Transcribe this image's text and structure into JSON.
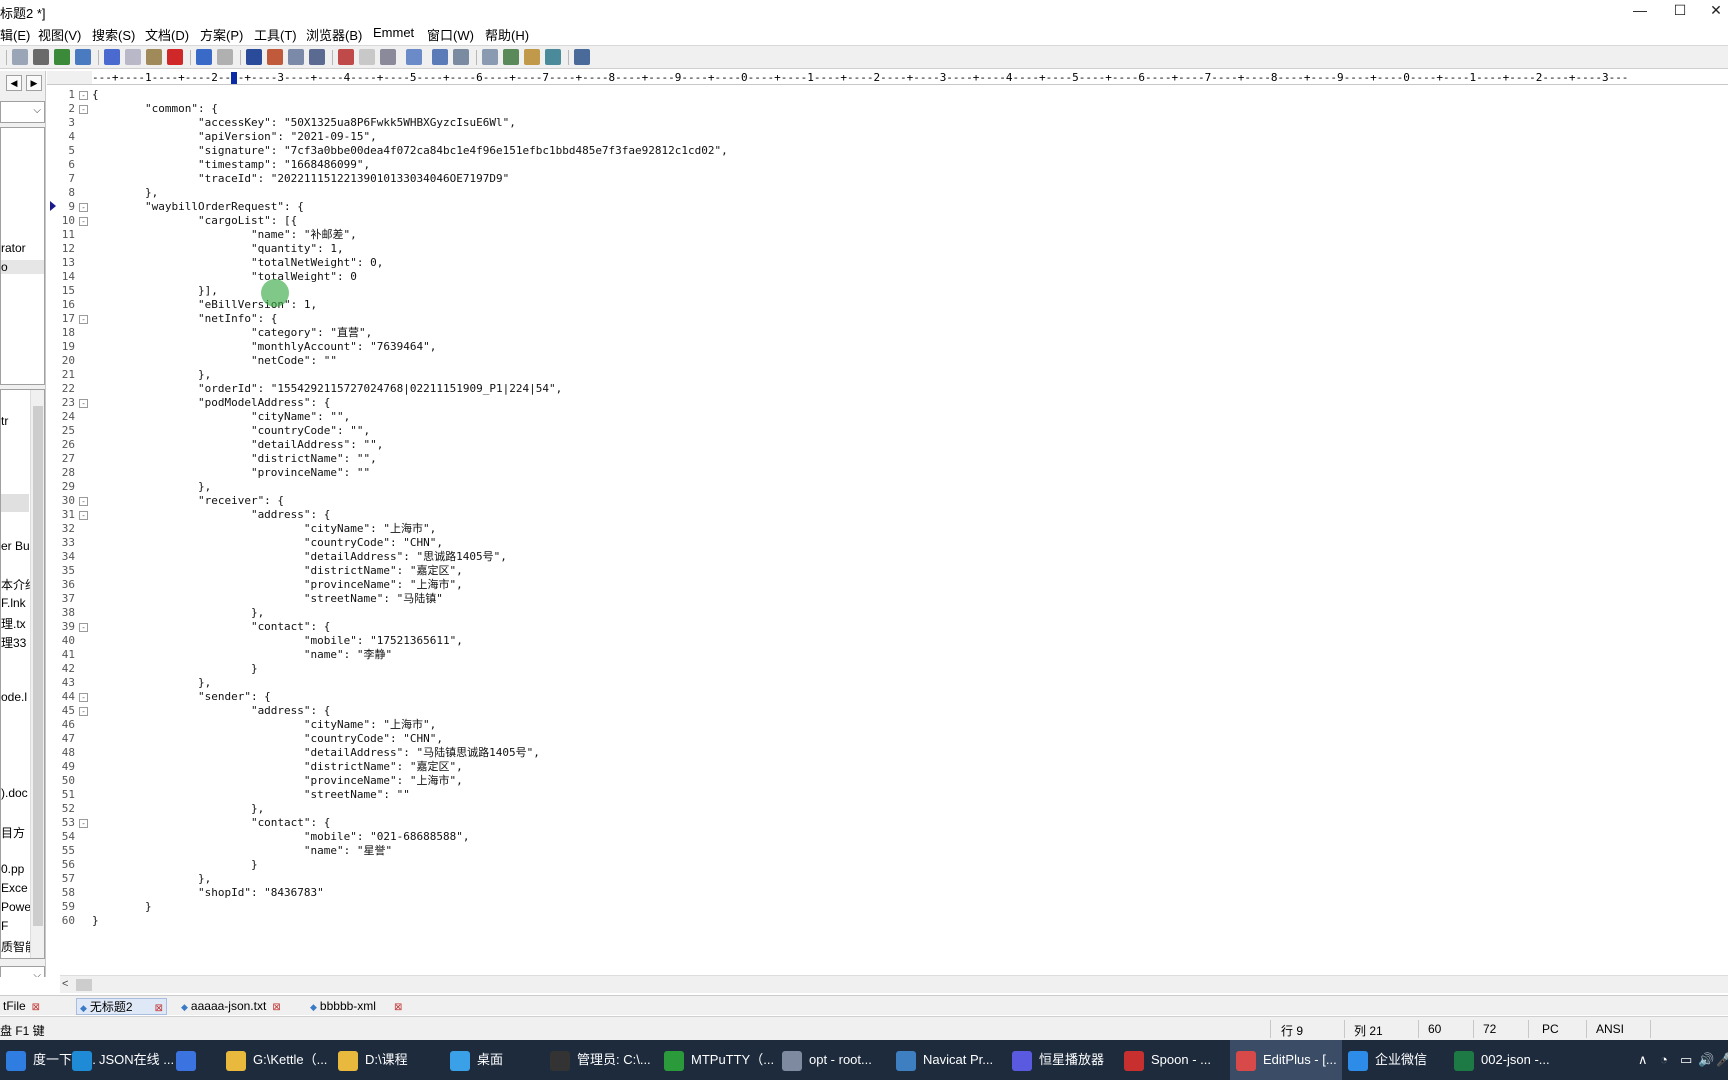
{
  "window": {
    "title": "标题2 *]",
    "controls": [
      "—",
      "☐",
      "✕"
    ]
  },
  "menu": [
    "辑(E)",
    "视图(V)",
    "搜索(S)",
    "文档(D)",
    "方案(P)",
    "工具(T)",
    "浏览器(B)",
    "Emmet",
    "窗口(W)",
    "帮助(H)"
  ],
  "leftpanel": {
    "top_items": [
      "rator",
      "o"
    ],
    "file_items": [
      "tr",
      "er Bu",
      "本介绍",
      "F.lnk",
      "理.tx",
      "理33",
      "ode.l",
      ").doc",
      "目方",
      "0.pp",
      "Exce",
      "Powe",
      "F",
      "质智能"
    ]
  },
  "ruler": {
    "text": "---+----1----+----2----+----3----+----4----+----5----+----6----+----7----+----8----+----9----+----0----+----1----+----2----+----3----+----4----+----5----+----6----+----7----+----8----+----9----+----0----+----1----+----2----+----3---"
  },
  "editor": {
    "current_line": 9,
    "lines": [
      {
        "n": "1",
        "fold": "-",
        "text": "{"
      },
      {
        "n": "2",
        "fold": "-",
        "text": "        \"common\": {"
      },
      {
        "n": "3",
        "fold": "",
        "text": "                \"accessKey\": \"50X1325ua8P6Fwkk5WHBXGyzcIsuE6Wl\","
      },
      {
        "n": "4",
        "fold": "",
        "text": "                \"apiVersion\": \"2021-09-15\","
      },
      {
        "n": "5",
        "fold": "",
        "text": "                \"signature\": \"7cf3a0bbe00dea4f072ca84bc1e4f96e151efbc1bbd485e7f3fae92812c1cd02\","
      },
      {
        "n": "6",
        "fold": "",
        "text": "                \"timestamp\": \"1668486099\","
      },
      {
        "n": "7",
        "fold": "",
        "text": "                \"traceId\": \"20221115122139010133034046OE7197D9\""
      },
      {
        "n": "8",
        "fold": "",
        "text": "        },"
      },
      {
        "n": "9",
        "fold": "-",
        "text": "        \"waybillOrderRequest\": {"
      },
      {
        "n": "10",
        "fold": "-",
        "text": "                \"cargoList\": [{"
      },
      {
        "n": "11",
        "fold": "",
        "text": "                        \"name\": \"补邮差\","
      },
      {
        "n": "12",
        "fold": "",
        "text": "                        \"quantity\": 1,"
      },
      {
        "n": "13",
        "fold": "",
        "text": "                        \"totalNetWeight\": 0,"
      },
      {
        "n": "14",
        "fold": "",
        "text": "                        \"totalWeight\": 0"
      },
      {
        "n": "15",
        "fold": "",
        "text": "                }],"
      },
      {
        "n": "16",
        "fold": "",
        "text": "                \"eBillVersion\": 1,"
      },
      {
        "n": "17",
        "fold": "-",
        "text": "                \"netInfo\": {"
      },
      {
        "n": "18",
        "fold": "",
        "text": "                        \"category\": \"直营\","
      },
      {
        "n": "19",
        "fold": "",
        "text": "                        \"monthlyAccount\": \"7639464\","
      },
      {
        "n": "20",
        "fold": "",
        "text": "                        \"netCode\": \"\""
      },
      {
        "n": "21",
        "fold": "",
        "text": "                },"
      },
      {
        "n": "22",
        "fold": "",
        "text": "                \"orderId\": \"1554292115727024768|02211151909_P1|224|54\","
      },
      {
        "n": "23",
        "fold": "-",
        "text": "                \"podModelAddress\": {"
      },
      {
        "n": "24",
        "fold": "",
        "text": "                        \"cityName\": \"\","
      },
      {
        "n": "25",
        "fold": "",
        "text": "                        \"countryCode\": \"\","
      },
      {
        "n": "26",
        "fold": "",
        "text": "                        \"detailAddress\": \"\","
      },
      {
        "n": "27",
        "fold": "",
        "text": "                        \"districtName\": \"\","
      },
      {
        "n": "28",
        "fold": "",
        "text": "                        \"provinceName\": \"\""
      },
      {
        "n": "29",
        "fold": "",
        "text": "                },"
      },
      {
        "n": "30",
        "fold": "-",
        "text": "                \"receiver\": {"
      },
      {
        "n": "31",
        "fold": "-",
        "text": "                        \"address\": {"
      },
      {
        "n": "32",
        "fold": "",
        "text": "                                \"cityName\": \"上海市\","
      },
      {
        "n": "33",
        "fold": "",
        "text": "                                \"countryCode\": \"CHN\","
      },
      {
        "n": "34",
        "fold": "",
        "text": "                                \"detailAddress\": \"思诚路1405号\","
      },
      {
        "n": "35",
        "fold": "",
        "text": "                                \"districtName\": \"嘉定区\","
      },
      {
        "n": "36",
        "fold": "",
        "text": "                                \"provinceName\": \"上海市\","
      },
      {
        "n": "37",
        "fold": "",
        "text": "                                \"streetName\": \"马陆镇\""
      },
      {
        "n": "38",
        "fold": "",
        "text": "                        },"
      },
      {
        "n": "39",
        "fold": "-",
        "text": "                        \"contact\": {"
      },
      {
        "n": "40",
        "fold": "",
        "text": "                                \"mobile\": \"17521365611\","
      },
      {
        "n": "41",
        "fold": "",
        "text": "                                \"name\": \"李静\""
      },
      {
        "n": "42",
        "fold": "",
        "text": "                        }"
      },
      {
        "n": "43",
        "fold": "",
        "text": "                },"
      },
      {
        "n": "44",
        "fold": "-",
        "text": "                \"sender\": {"
      },
      {
        "n": "45",
        "fold": "-",
        "text": "                        \"address\": {"
      },
      {
        "n": "46",
        "fold": "",
        "text": "                                \"cityName\": \"上海市\","
      },
      {
        "n": "47",
        "fold": "",
        "text": "                                \"countryCode\": \"CHN\","
      },
      {
        "n": "48",
        "fold": "",
        "text": "                                \"detailAddress\": \"马陆镇思诚路1405号\","
      },
      {
        "n": "49",
        "fold": "",
        "text": "                                \"districtName\": \"嘉定区\","
      },
      {
        "n": "50",
        "fold": "",
        "text": "                                \"provinceName\": \"上海市\","
      },
      {
        "n": "51",
        "fold": "",
        "text": "                                \"streetName\": \"\""
      },
      {
        "n": "52",
        "fold": "",
        "text": "                        },"
      },
      {
        "n": "53",
        "fold": "-",
        "text": "                        \"contact\": {"
      },
      {
        "n": "54",
        "fold": "",
        "text": "                                \"mobile\": \"021-68688588\","
      },
      {
        "n": "55",
        "fold": "",
        "text": "                                \"name\": \"星誉\""
      },
      {
        "n": "56",
        "fold": "",
        "text": "                        }"
      },
      {
        "n": "57",
        "fold": "",
        "text": "                },"
      },
      {
        "n": "58",
        "fold": "",
        "text": "                \"shopId\": \"8436783\""
      },
      {
        "n": "59",
        "fold": "",
        "text": "        }"
      },
      {
        "n": "60",
        "fold": "",
        "text": "}"
      }
    ]
  },
  "doctabs": [
    {
      "label": "tFile",
      "active": false
    },
    {
      "label": "无标题2",
      "active": true
    },
    {
      "label": "aaaaa-json.txt",
      "active": false
    },
    {
      "label": "bbbbb-xml",
      "active": false
    }
  ],
  "status": {
    "hint": "盘 F1 键",
    "line": "行 9",
    "col": "列 21",
    "v1": "60",
    "v2": "72",
    "mode": "PC",
    "encoding": "ANSI"
  },
  "taskbar": {
    "items": [
      {
        "label": "度一下，...",
        "icon_color": "#2f7de1",
        "icon": "browser-icon",
        "active": false
      },
      {
        "label": "JSON在线 ...",
        "icon_color": "#1f8bd6",
        "icon": "edge-icon",
        "active": false
      },
      {
        "label": "",
        "icon_color": "#3b74e0",
        "icon": "feishu-icon",
        "active": false
      },
      {
        "label": "G:\\Kettle（...",
        "icon_color": "#e8b93c",
        "icon": "folder-icon",
        "active": false
      },
      {
        "label": "D:\\课程",
        "icon_color": "#e8b93c",
        "icon": "folder-icon",
        "active": false
      },
      {
        "label": "桌面",
        "icon_color": "#3aa0e8",
        "icon": "desktop-icon",
        "active": false
      },
      {
        "label": "管理员: C:\\...",
        "icon_color": "#333333",
        "icon": "terminal-icon",
        "active": false
      },
      {
        "label": "MTPuTTY（...",
        "icon_color": "#2a9a3a",
        "icon": "putty-icon",
        "active": false
      },
      {
        "label": "opt - root...",
        "icon_color": "#7d8aa0",
        "icon": "ssh-icon",
        "active": false
      },
      {
        "label": "Navicat Pr...",
        "icon_color": "#3d7fc0",
        "icon": "navicat-icon",
        "active": false
      },
      {
        "label": "恒星播放器",
        "icon_color": "#5a5ae0",
        "icon": "player-icon",
        "active": false
      },
      {
        "label": "Spoon - ...",
        "icon_color": "#c83030",
        "icon": "spoon-icon",
        "active": false
      },
      {
        "label": "EditPlus - [...",
        "icon_color": "#d84a4a",
        "icon": "editplus-icon",
        "active": true
      },
      {
        "label": "企业微信",
        "icon_color": "#2c8ce8",
        "icon": "wecom-icon",
        "active": false
      },
      {
        "label": "002-json -...",
        "icon_color": "#1d7a45",
        "icon": "excel-icon",
        "active": false
      }
    ],
    "tray": [
      "∧",
      "◔",
      "▭",
      "🔊",
      "🎤"
    ]
  }
}
